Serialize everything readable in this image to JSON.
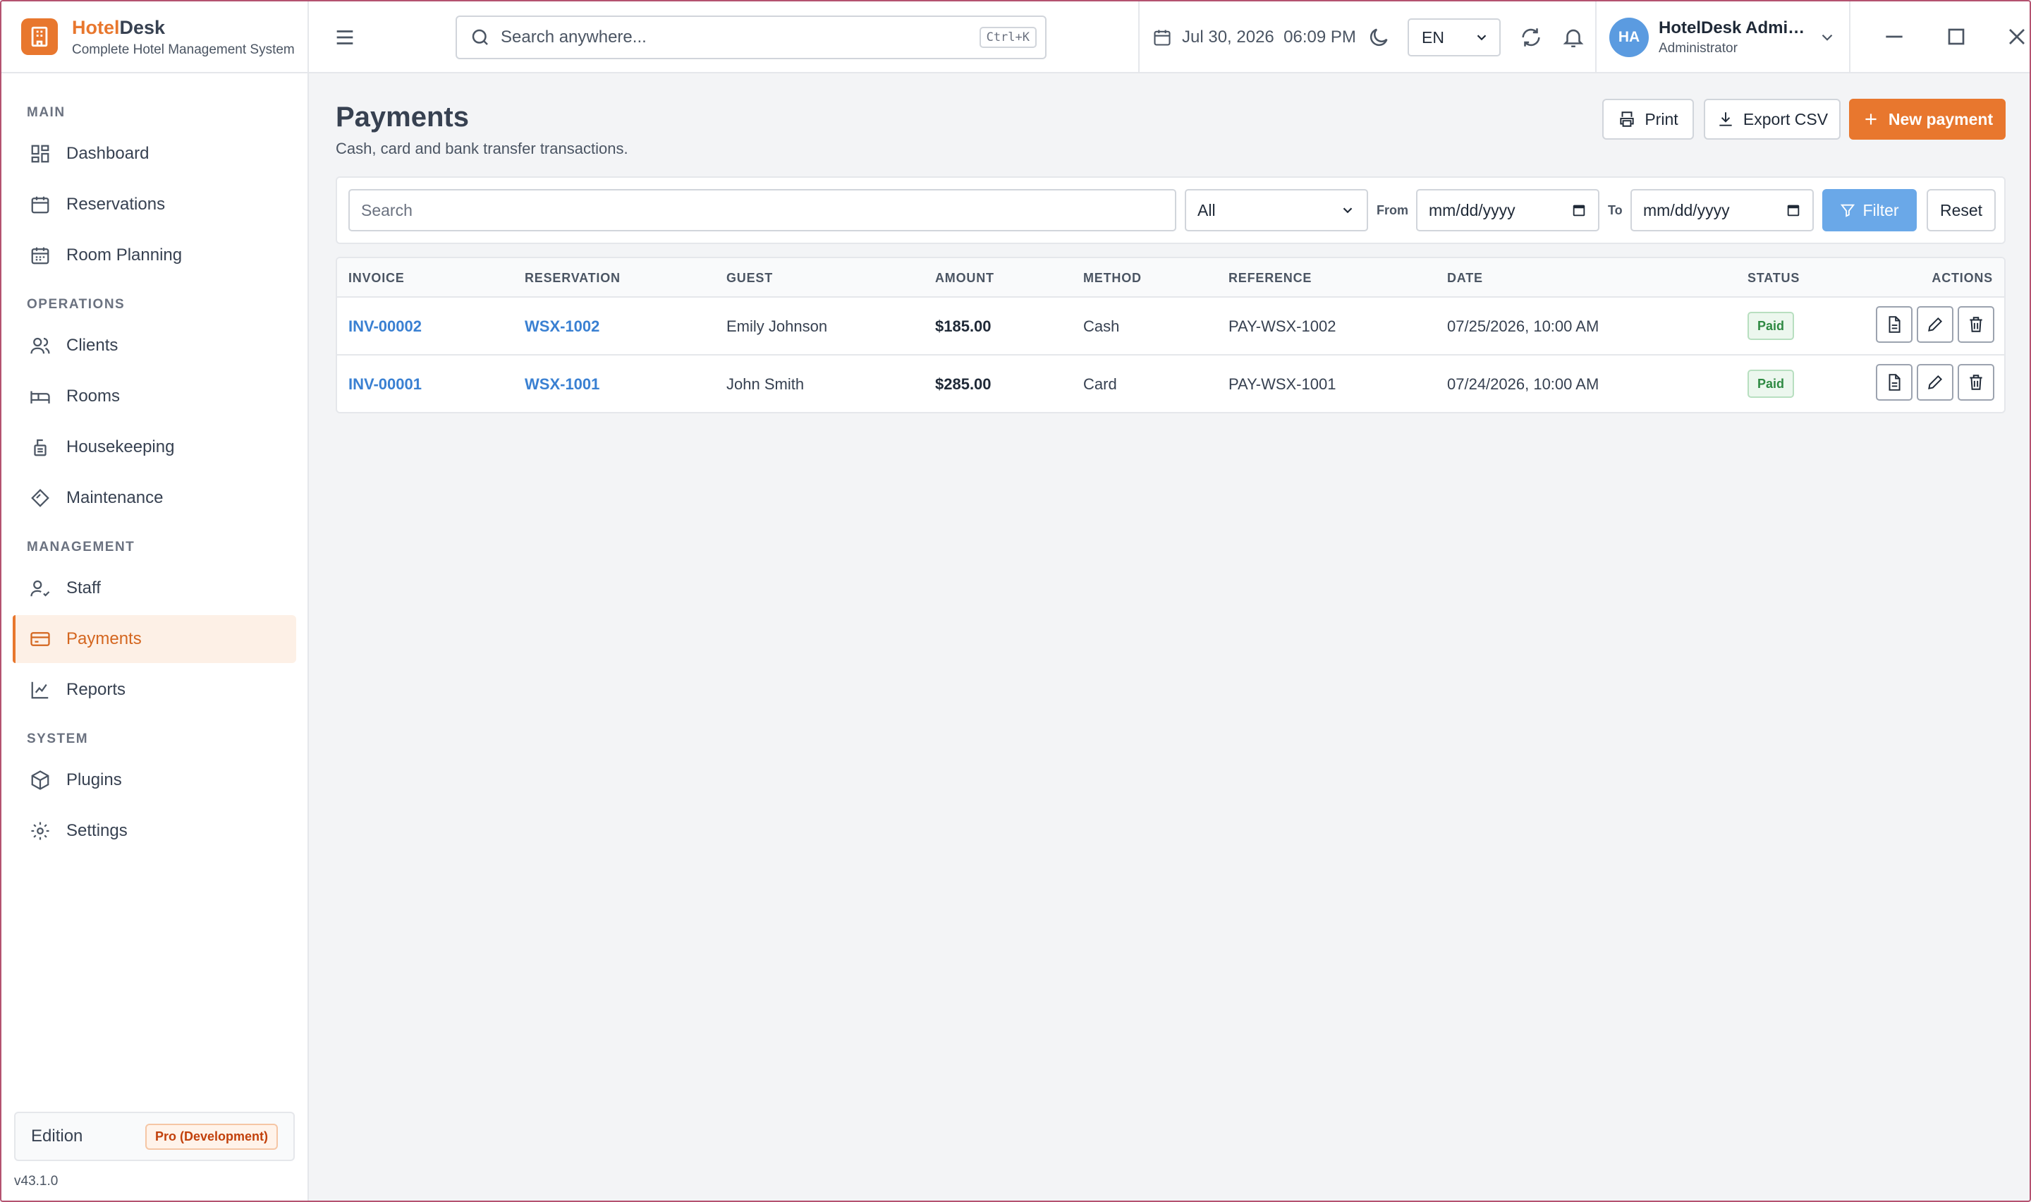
{
  "brand": {
    "name_accent": "Hotel",
    "name_rest": "Desk",
    "subtitle": "Complete Hotel Management System"
  },
  "sidebar": {
    "sections": [
      {
        "label": "MAIN",
        "items": [
          {
            "label": "Dashboard",
            "icon": "dashboard-icon"
          },
          {
            "label": "Reservations",
            "icon": "calendar-icon"
          },
          {
            "label": "Room Planning",
            "icon": "calendar-grid-icon"
          }
        ]
      },
      {
        "label": "OPERATIONS",
        "items": [
          {
            "label": "Clients",
            "icon": "users-icon"
          },
          {
            "label": "Rooms",
            "icon": "bed-icon"
          },
          {
            "label": "Housekeeping",
            "icon": "housekeeping-icon"
          },
          {
            "label": "Maintenance",
            "icon": "wrench-icon"
          }
        ]
      },
      {
        "label": "MANAGEMENT",
        "items": [
          {
            "label": "Staff",
            "icon": "staff-icon"
          },
          {
            "label": "Payments",
            "icon": "credit-card-icon",
            "active": true
          },
          {
            "label": "Reports",
            "icon": "chart-line-icon"
          }
        ]
      },
      {
        "label": "SYSTEM",
        "items": [
          {
            "label": "Plugins",
            "icon": "package-icon"
          },
          {
            "label": "Settings",
            "icon": "gear-icon"
          }
        ]
      }
    ],
    "edition_label": "Edition",
    "edition_value": "Pro (Development)",
    "version": "v43.1.0"
  },
  "topbar": {
    "search_placeholder": "Search anywhere...",
    "search_shortcut": "Ctrl+K",
    "date": "Jul 30, 2026",
    "time": "06:09 PM",
    "language": "EN",
    "user_initials": "HA",
    "user_name": "HotelDesk Administrator",
    "user_role": "Administrator"
  },
  "page": {
    "title": "Payments",
    "subtitle": "Cash, card and bank transfer transactions.",
    "print_label": "Print",
    "export_label": "Export CSV",
    "new_label": "New payment"
  },
  "filters": {
    "search_placeholder": "Search",
    "method_value": "All",
    "from_label": "From",
    "from_placeholder": "mm/dd/yyyy",
    "to_label": "To",
    "to_placeholder": "mm/dd/yyyy",
    "filter_label": "Filter",
    "reset_label": "Reset"
  },
  "table": {
    "columns": [
      "INVOICE",
      "RESERVATION",
      "GUEST",
      "AMOUNT",
      "METHOD",
      "REFERENCE",
      "DATE",
      "STATUS",
      "ACTIONS"
    ],
    "rows": [
      {
        "invoice": "INV-00002",
        "reservation": "WSX-1002",
        "guest": "Emily Johnson",
        "amount": "$185.00",
        "method": "Cash",
        "reference": "PAY-WSX-1002",
        "date": "07/25/2026, 10:00 AM",
        "status": "Paid"
      },
      {
        "invoice": "INV-00001",
        "reservation": "WSX-1001",
        "guest": "John Smith",
        "amount": "$285.00",
        "method": "Card",
        "reference": "PAY-WSX-1001",
        "date": "07/24/2026, 10:00 AM",
        "status": "Paid"
      }
    ]
  },
  "colors": {
    "accent": "#e8772e",
    "link": "#3a80d2",
    "paid": "#2f8a43",
    "filter_button": "#6aa8e8"
  }
}
